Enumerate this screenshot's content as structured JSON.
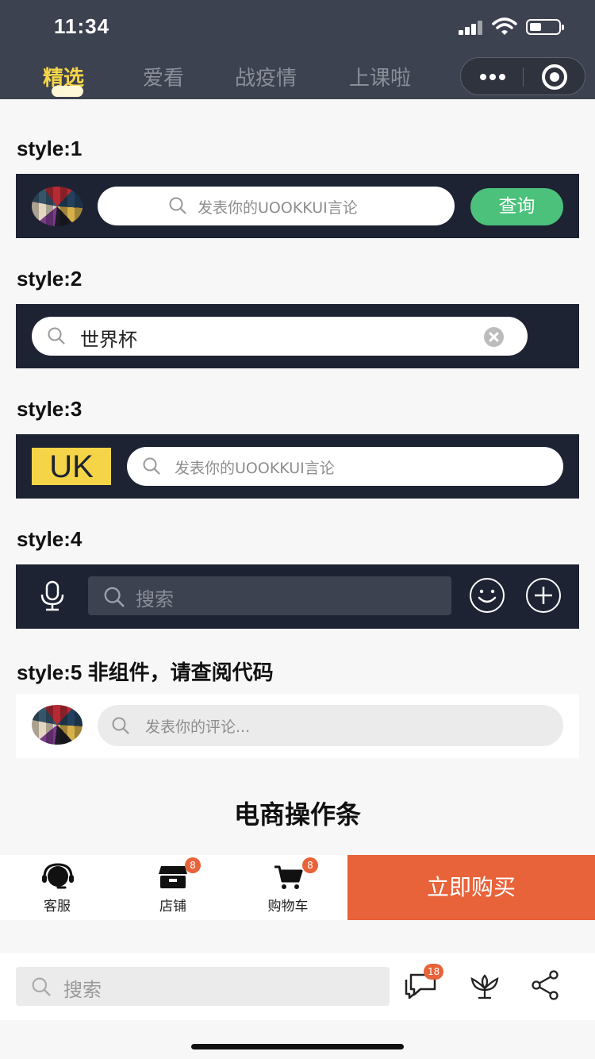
{
  "status": {
    "time": "11:34"
  },
  "nav": {
    "tabs": [
      {
        "label": "精选",
        "active": true
      },
      {
        "label": "爱看",
        "active": false
      },
      {
        "label": "战疫情",
        "active": false
      },
      {
        "label": "上课啦",
        "active": false
      }
    ],
    "more_icon": "more-dots-icon",
    "close_icon": "target-icon"
  },
  "sections": [
    {
      "title": "style:1",
      "placeholder": "发表你的UOOKKUI言论",
      "button": "查询"
    },
    {
      "title": "style:2",
      "value": "世界杯"
    },
    {
      "title": "style:3",
      "logo": "UK",
      "placeholder": "发表你的UOOKKUI言论"
    },
    {
      "title": "style:4",
      "placeholder": "搜索"
    },
    {
      "title": "style:5 非组件，请查阅代码",
      "placeholder": "发表你的评论..."
    }
  ],
  "ecommerce": {
    "title": "电商操作条",
    "actions": [
      {
        "label": "客服",
        "icon": "customer-service-icon"
      },
      {
        "label": "店铺",
        "icon": "shop-icon",
        "badge": "8"
      },
      {
        "label": "购物车",
        "icon": "cart-icon",
        "badge": "8"
      }
    ],
    "buy_label": "立即购买"
  },
  "bottom_bar": {
    "placeholder": "搜索",
    "comment_badge": "18",
    "icons": [
      "comment-icon",
      "flower-icon",
      "share-icon"
    ]
  },
  "colors": {
    "accent_green": "#4cc17b",
    "accent_orange": "#e8623a",
    "tab_active": "#f5d547",
    "bar_dark": "#1d2333"
  }
}
